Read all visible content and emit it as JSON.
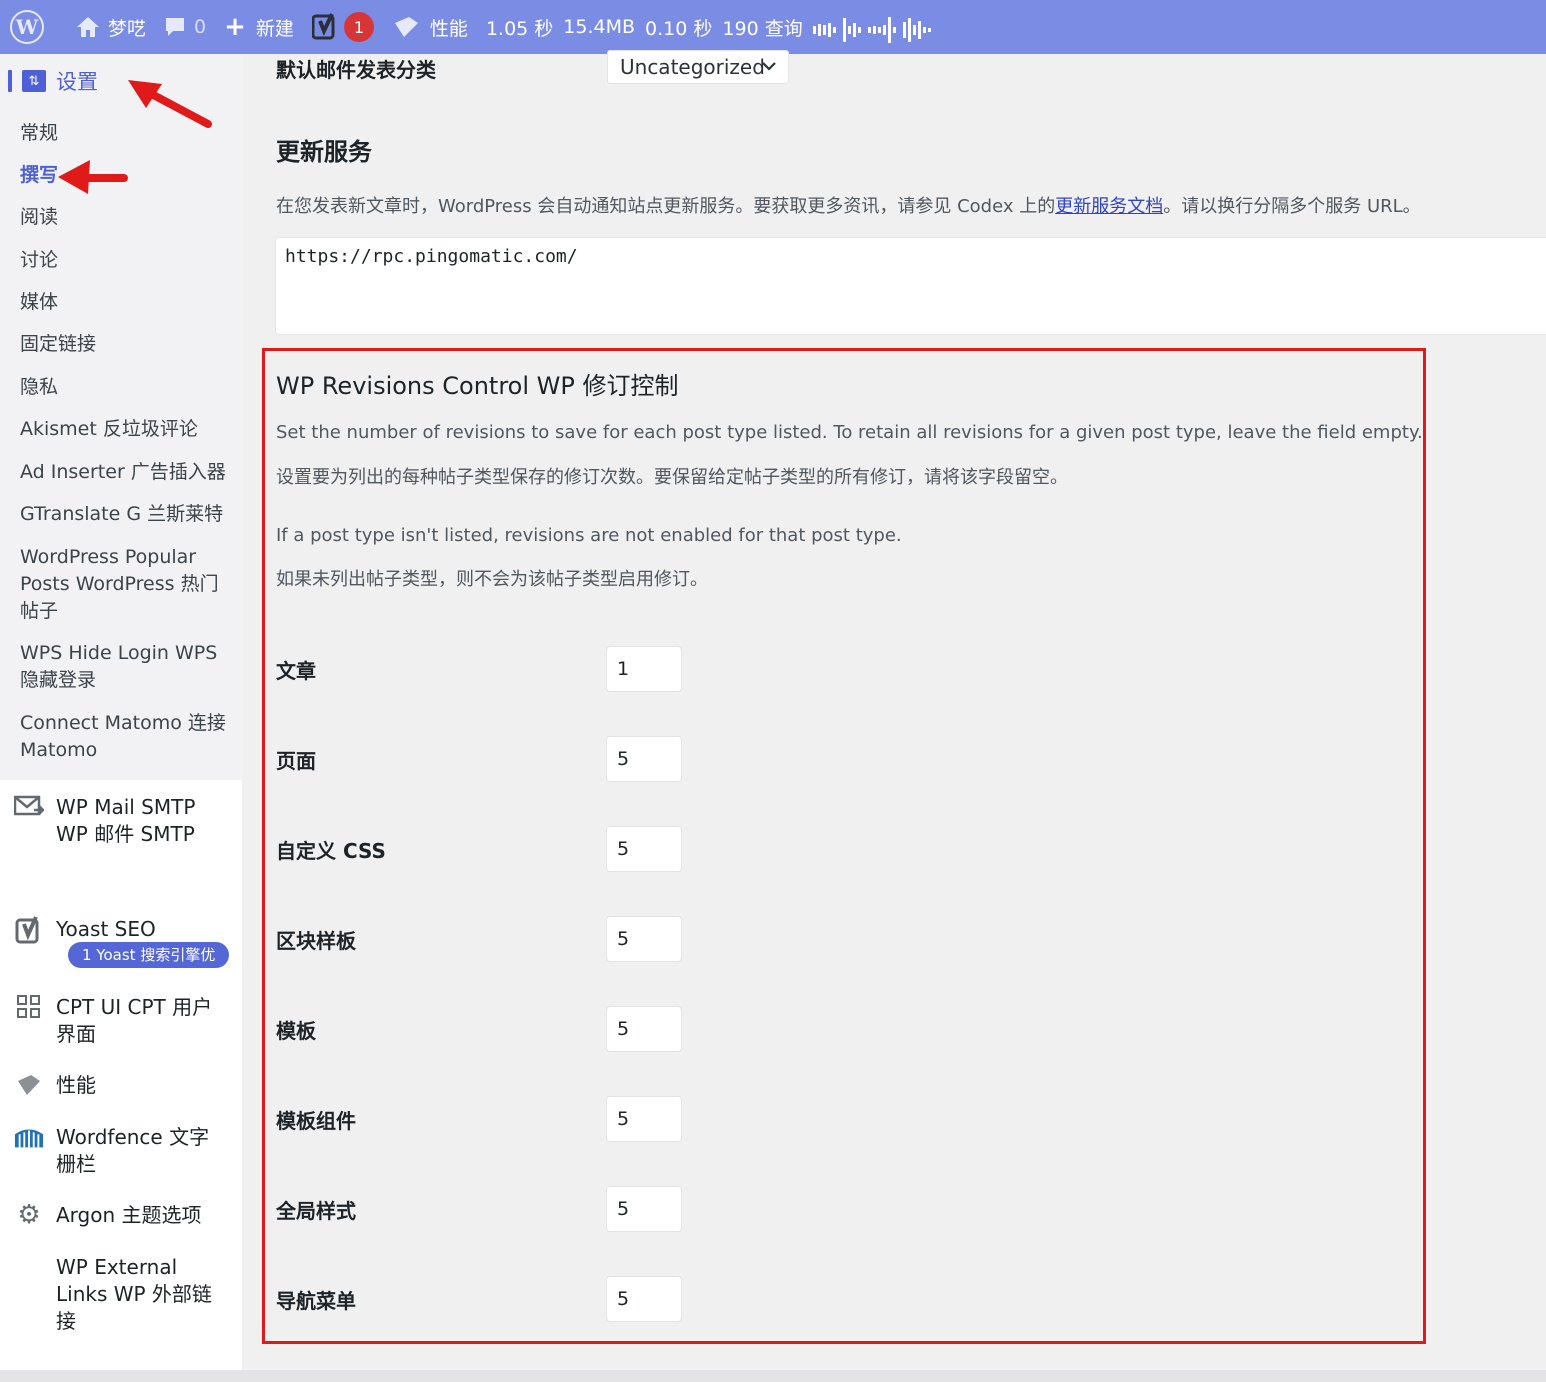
{
  "adminbar": {
    "site_name": "梦呓",
    "comments_count": "0",
    "new_label": "新建",
    "yoast_badge": "1",
    "perf_label": "性能",
    "time": "1.05 秒",
    "memory": "15.4MB",
    "query_time": "0.10 秒",
    "queries": "190 查询"
  },
  "sidebar": {
    "settings_label": "设置",
    "sub_items": [
      "常规",
      "撰写",
      "阅读",
      "讨论",
      "媒体",
      "固定链接",
      "隐私",
      "Akismet 反垃圾评论",
      "Ad Inserter 广告插入器",
      "GTranslate G 兰斯莱特",
      "WordPress Popular Posts WordPress 热门帖子",
      "WPS Hide Login WPS 隐藏登录",
      "Connect Matomo 连接 Matomo"
    ],
    "top_items": [
      "WP Mail SMTP WP 邮件 SMTP",
      "Yoast SEO",
      "CPT UI CPT 用户界面",
      "性能",
      "Wordfence 文字栅栏",
      "Argon 主题选项",
      "WP External Links WP 外部链接"
    ],
    "yoast_pill": "1 Yoast 搜索引擎优"
  },
  "main": {
    "default_mail_category_label": "默认邮件发表分类",
    "default_mail_category_value": "Uncategorized",
    "update_services_title": "更新服务",
    "update_services_desc_pre": "在您发表新文章时，WordPress 会自动通知站点更新服务。要获取更多资讯，请参见 Codex 上的",
    "update_services_link": "更新服务文档",
    "update_services_desc_post": "。请以换行分隔多个服务 URL。",
    "ping_urls": "https://rpc.pingomatic.com/",
    "revisions_title": "WP Revisions Control WP 修订控制",
    "revisions_desc_en": "Set the number of revisions to save for each post type listed. To retain all revisions for a given post type, leave the field empty.",
    "revisions_desc_zh": "设置要为列出的每种帖子类型保存的修订次数。要保留给定帖子类型的所有修订，请将该字段留空。",
    "not_listed_en": "If a post type isn't listed, revisions are not enabled for that post type.",
    "not_listed_zh": "如果未列出帖子类型，则不会为该帖子类型启用修订。",
    "post_types": [
      {
        "label": "文章",
        "value": "1"
      },
      {
        "label": "页面",
        "value": "5"
      },
      {
        "label": "自定义 CSS",
        "value": "5"
      },
      {
        "label": "区块样板",
        "value": "5"
      },
      {
        "label": "模板",
        "value": "5"
      },
      {
        "label": "模板组件",
        "value": "5"
      },
      {
        "label": "全局样式",
        "value": "5"
      },
      {
        "label": "导航菜单",
        "value": "5"
      }
    ]
  },
  "colors": {
    "adminbar": "#7b8ce4",
    "accent": "#4f5fd8",
    "highlight_box": "#e01a1a"
  }
}
